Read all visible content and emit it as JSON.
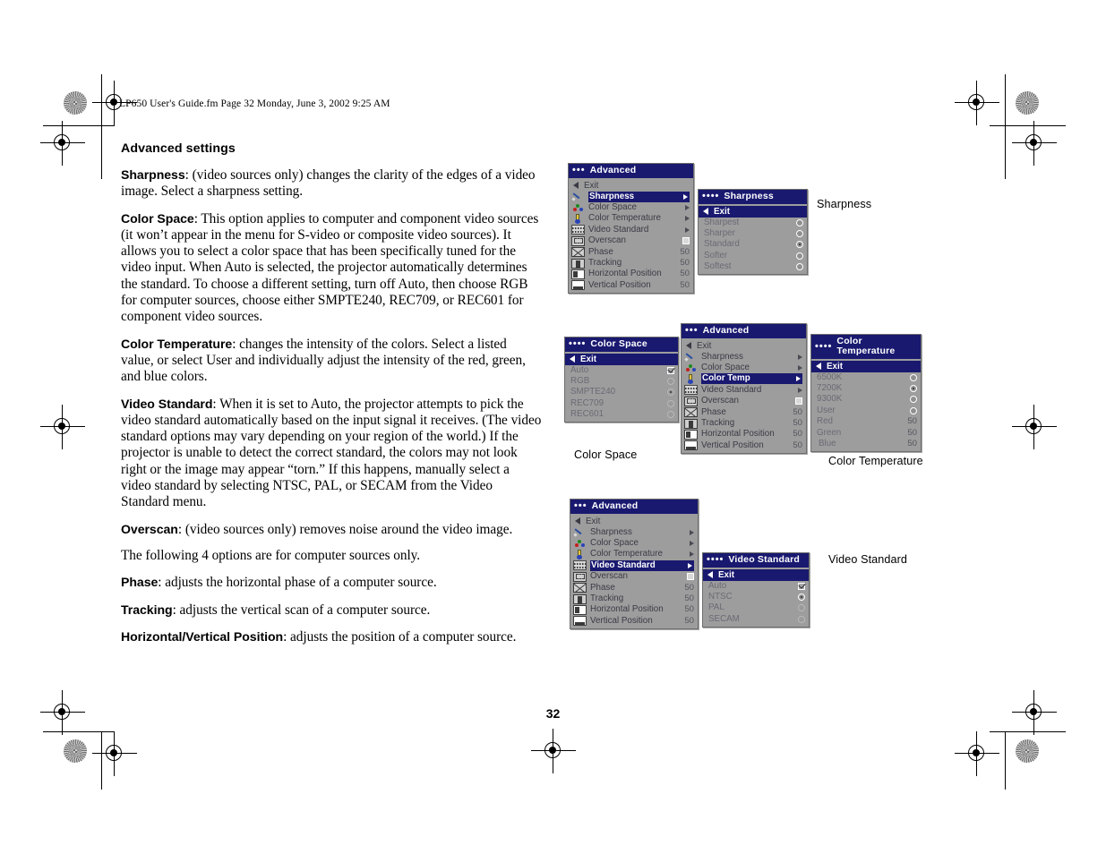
{
  "document": {
    "slug": "LP650 User's Guide.fm  Page 32  Monday, June 3, 2002  9:25 AM",
    "page_number": "32",
    "heading": "Advanced settings",
    "paragraphs": [
      {
        "term": "Sharpness",
        "text": ": (video sources only) changes the clarity of the edges of a video image. Select a sharpness setting."
      },
      {
        "term": "Color Space",
        "text": ": This option applies to computer and component video sources (it won’t appear in the menu for S-video or composite video sources). It allows you to select a color space that has been specifically tuned for the video input. When Auto is selected, the projector automatically determines the standard. To choose a different setting, turn off Auto, then choose RGB for computer sources, choose either SMPTE240, REC709, or REC601 for component video sources."
      },
      {
        "term": "Color Temperature",
        "text": ": changes the intensity of the colors. Select a listed value, or select User and individually adjust the intensity of the red, green, and blue colors."
      },
      {
        "term": "Video Standard",
        "text": ": When it is set to Auto, the projector attempts to pick the video standard automatically based on the input signal it receives. (The video standard options may vary depending on your region of the world.) If the projector is unable to detect the correct standard, the colors may not look right or the image may appear “torn.” If this happens, manually select a video standard by selecting NTSC, PAL, or SECAM from the Video Standard menu."
      },
      {
        "term": "Overscan",
        "text": ": (video sources only) removes noise around the video image."
      },
      {
        "term": "",
        "text": "The following 4 options are for computer sources only."
      },
      {
        "term": "Phase",
        "text": ": adjusts the horizontal phase of a computer source."
      },
      {
        "term": "Tracking",
        "text": ": adjusts the vertical scan of a computer source."
      },
      {
        "term": "Horizontal/Vertical Position",
        "text": ": adjusts the position of a computer source."
      }
    ]
  },
  "colors": {
    "menu_title_bg": "#191970",
    "menu_bg": "#9d9d9d",
    "menu_border": "#6e6e6e",
    "highlight_bg": "#191970",
    "highlight_fg": "#ffffff",
    "label_fg": "#3a3a46"
  },
  "captions": {
    "sharpness": "Sharpness",
    "color_space": "Color Space",
    "color_temperature": "Color Temperature",
    "video_standard": "Video Standard"
  },
  "advanced_menu": {
    "title": "Advanced",
    "title_dots": "•••",
    "exit": "Exit",
    "items": [
      {
        "label": "Sharpness",
        "icon": "pen-icon",
        "type": "submenu"
      },
      {
        "label": "Color Space",
        "icon": "color-dots-icon",
        "type": "submenu"
      },
      {
        "label": "Color Temperature",
        "icon": "thermometer-icon",
        "type": "submenu"
      },
      {
        "label": "Video Standard",
        "icon": "filmstrip-icon",
        "type": "submenu"
      },
      {
        "label": "Overscan",
        "icon": "overscan-icon",
        "type": "checkbox",
        "value": ""
      },
      {
        "label": "Phase",
        "icon": "phase-icon",
        "type": "value",
        "value": "50"
      },
      {
        "label": "Tracking",
        "icon": "tracking-icon",
        "type": "value",
        "value": "50"
      },
      {
        "label": "Horizontal Position",
        "icon": "h-position-icon",
        "type": "value",
        "value": "50"
      },
      {
        "label": "Vertical Position",
        "icon": "v-position-icon",
        "type": "value",
        "value": "50"
      }
    ],
    "variant_color_temp_label": "Color Temp",
    "selected_top": "Sharpness",
    "selected_middle": "Color Temp",
    "selected_bottom": "Video Standard"
  },
  "sharpness_menu": {
    "title": "Sharpness",
    "title_dots": "••••",
    "exit": "Exit",
    "options": [
      {
        "label": "Sharpest",
        "selected": false
      },
      {
        "label": "Sharper",
        "selected": false
      },
      {
        "label": "Standard",
        "selected": true
      },
      {
        "label": "Softer",
        "selected": false
      },
      {
        "label": "Softest",
        "selected": false
      }
    ]
  },
  "color_space_menu": {
    "title": "Color Space",
    "title_dots": "••••",
    "exit": "Exit",
    "auto": {
      "label": "Auto",
      "checked": true
    },
    "options": [
      {
        "label": "RGB",
        "selected": false
      },
      {
        "label": "SMPTE240",
        "selected": true
      },
      {
        "label": "REC709",
        "selected": false
      },
      {
        "label": "REC601",
        "selected": false
      }
    ]
  },
  "color_temperature_menu": {
    "title": "Color Temperature",
    "title_dots": "••••",
    "exit": "Exit",
    "options": [
      {
        "label": "6500K",
        "selected": false
      },
      {
        "label": "7200K",
        "selected": true
      },
      {
        "label": "9300K",
        "selected": false
      },
      {
        "label": "User",
        "selected": false
      }
    ],
    "sliders": [
      {
        "label": "Red",
        "value": "50"
      },
      {
        "label": "Green",
        "value": "50"
      },
      {
        "label": "Blue",
        "value": "50"
      }
    ]
  },
  "video_standard_menu": {
    "title": "Video Standard",
    "title_dots": "••••",
    "exit": "Exit",
    "auto": {
      "label": "Auto",
      "checked": true
    },
    "options": [
      {
        "label": "NTSC",
        "selected": true
      },
      {
        "label": "PAL",
        "selected": false
      },
      {
        "label": "SECAM",
        "selected": false
      }
    ]
  }
}
